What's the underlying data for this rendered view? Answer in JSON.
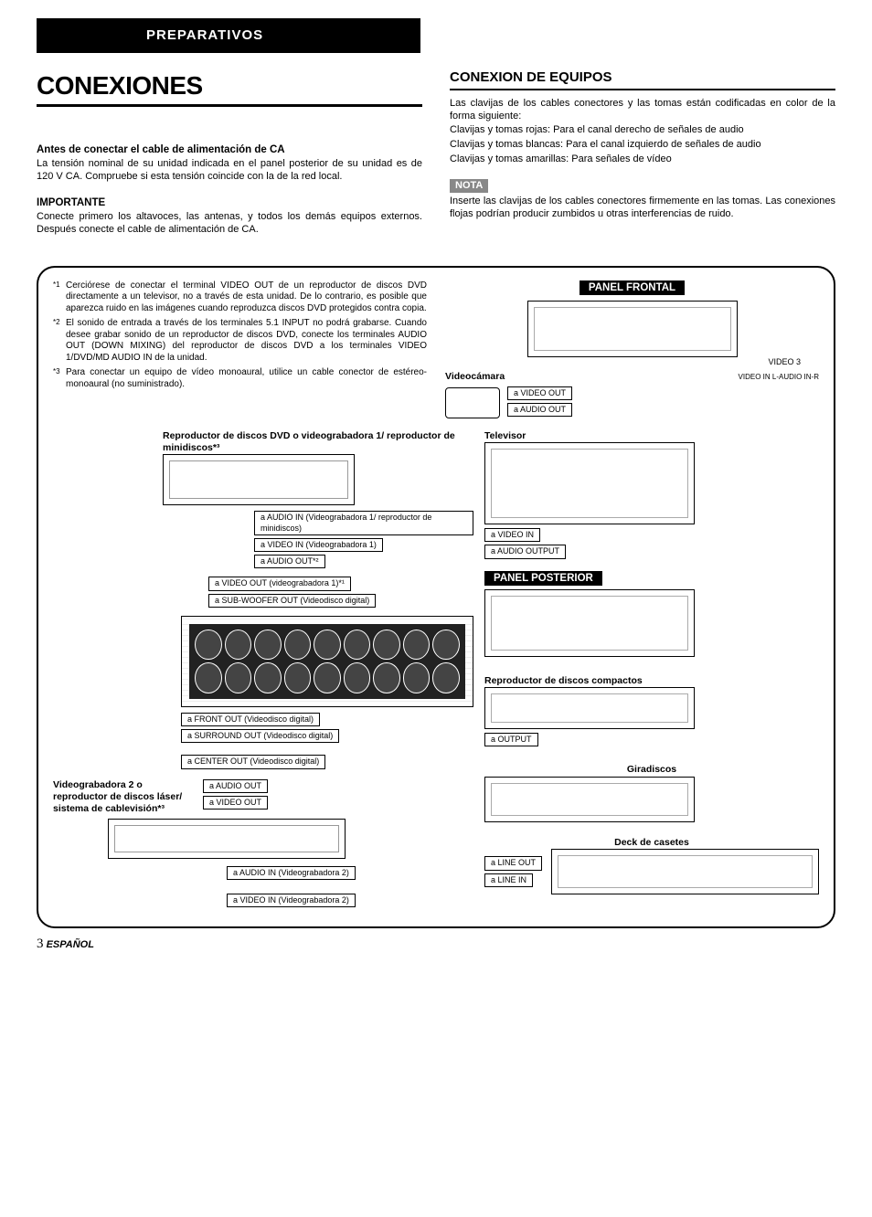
{
  "header": {
    "tab": "PREPARATIVOS"
  },
  "left": {
    "title": "CONEXIONES",
    "sub1_head": "Antes de conectar el cable de alimentación de CA",
    "sub1_body": "La tensión nominal de su unidad indicada en el panel posterior de su unidad es de 120 V CA. Compruebe si esta tensión coincide con la de la red local.",
    "sub2_head": "IMPORTANTE",
    "sub2_body": "Conecte primero los altavoces, las antenas, y todos los demás equipos externos. Después conecte el cable de alimentación de CA."
  },
  "right": {
    "title": "CONEXION DE EQUIPOS",
    "intro": "Las clavijas de los cables conectores y las tomas están codificadas en color de la forma siguiente:",
    "line_r": "Clavijas y tomas rojas: Para el canal derecho de señales de audio",
    "line_w": "Clavijas y tomas blancas: Para el canal izquierdo de señales de audio",
    "line_y": "Clavijas y tomas amarillas: Para señales de vídeo",
    "nota_label": "NOTA",
    "nota_body": "Inserte las clavijas de los cables conectores firmemente en las tomas. Las conexiones flojas podrían producir zumbidos u otras interferencias de ruido."
  },
  "footnotes": {
    "n1": "Cerciórese de conectar el terminal VIDEO OUT de un reproductor de discos DVD directamente a un televisor, no a través de esta unidad. De lo contrario, es posible que aparezca ruido en las imágenes cuando reproduzca discos DVD protegidos contra copia.",
    "n2": "El sonido de entrada a través de los terminales 5.1 INPUT no podrá grabarse. Cuando desee grabar sonido de un reproductor de discos DVD, conecte los terminales AUDIO OUT (DOWN MIXING) del reproductor de discos DVD a los terminales VIDEO 1/DVD/MD AUDIO IN de la unidad.",
    "n3": "Para conectar un equipo de vídeo monoaural, utilice un cable conector de estéreo-monoaural (no suministrado)."
  },
  "panels": {
    "front": "PANEL FRONTAL",
    "rear": "PANEL POSTERIOR",
    "video3": "VIDEO 3",
    "videoin_audio": "VIDEO IN   L-AUDIO IN-R",
    "camcorder": "Videocámara",
    "cam_vo": "a VIDEO OUT",
    "cam_ao": "a AUDIO OUT"
  },
  "devices": {
    "dvd_title": "Reproductor de discos DVD o videograbadora 1/ reproductor de minidiscos*³",
    "tv": "Televisor",
    "cd": "Reproductor de discos compactos",
    "turntable": "Giradiscos",
    "tape": "Deck de casetes",
    "vcr2": "Videograbadora 2 o reproductor de discos láser/ sistema de cablevisión*³"
  },
  "labels": {
    "a_audio_in_vcr1": "a AUDIO IN (Videograbadora 1/ reproductor de minidiscos)",
    "a_video_in_vcr1": "a VIDEO IN (Videograbadora 1)",
    "a_audio_out2": "a AUDIO OUT*²",
    "a_video_out_vcr1": "a VIDEO OUT (videograbadora 1)*¹",
    "a_subwoofer": "a SUB-WOOFER OUT (Videodisco digital)",
    "a_front_out": "a FRONT OUT (Videodisco digital)",
    "a_surround_out": "a SURROUND OUT (Videodisco digital)",
    "a_center_out": "a CENTER OUT (Videodisco digital)",
    "a_audio_out": "a AUDIO OUT",
    "a_video_out": "a VIDEO OUT",
    "a_audio_in_vcr2": "a AUDIO IN (Videograbadora 2)",
    "a_video_in_vcr2": "a VIDEO IN (Videograbadora 2)",
    "a_video_in": "a VIDEO IN",
    "a_audio_output": "a AUDIO OUTPUT",
    "a_output": "a OUTPUT",
    "a_line_out": "a LINE OUT",
    "a_line_in": "a LINE IN"
  },
  "footer": {
    "page": "3",
    "lang": "ESPAÑOL"
  }
}
